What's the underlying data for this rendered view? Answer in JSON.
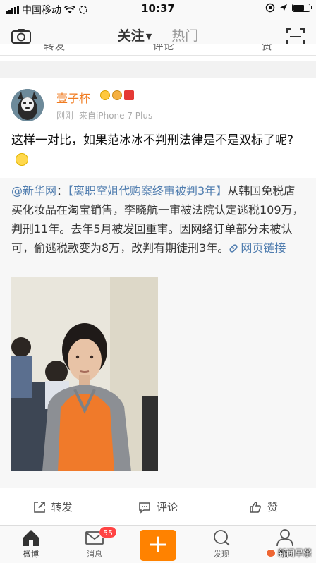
{
  "status_bar": {
    "carrier": "中国移动",
    "time": "10:37"
  },
  "nav": {
    "tab_follow": "关注",
    "tab_hot": "热门"
  },
  "prev_post_actions": {
    "repost": "转发",
    "comment": "评论",
    "like": "赞"
  },
  "post": {
    "username": "壹子杯",
    "time": "刚刚",
    "source": "来自iPhone 7 Plus",
    "text": "这样一对比，如果范冰冰不判刑法律是不是双标了呢?",
    "repost": {
      "mention": "@新华网",
      "colon": "：",
      "tag": "【离职空姐代购案终审被判3年】",
      "body": "从韩国免税店买化妆品在淘宝销售，李晓航一审被法院认定逃税109万，判刑11年。去年5月被发回重审。因网络订单部分未被认可，偷逃税款变为8万，改判有期徒刑3年。",
      "link_label": "网页链接"
    },
    "actions": {
      "repost": "转发",
      "comment": "评论",
      "like": "赞"
    }
  },
  "tab_bar": {
    "home": "微博",
    "messages": "消息",
    "messages_badge": "55",
    "compose": "+",
    "discover": "发现",
    "me": "我"
  },
  "watermark": "新闻早茶",
  "colors": {
    "accent": "#ff8200",
    "link": "#507daf",
    "username": "#f07b20",
    "badge": "#ff4444"
  },
  "icons": [
    "camera-icon",
    "scan-icon",
    "share-icon",
    "comment-icon",
    "like-icon",
    "home-icon",
    "mail-icon",
    "discover-icon",
    "profile-icon",
    "link-icon"
  ]
}
